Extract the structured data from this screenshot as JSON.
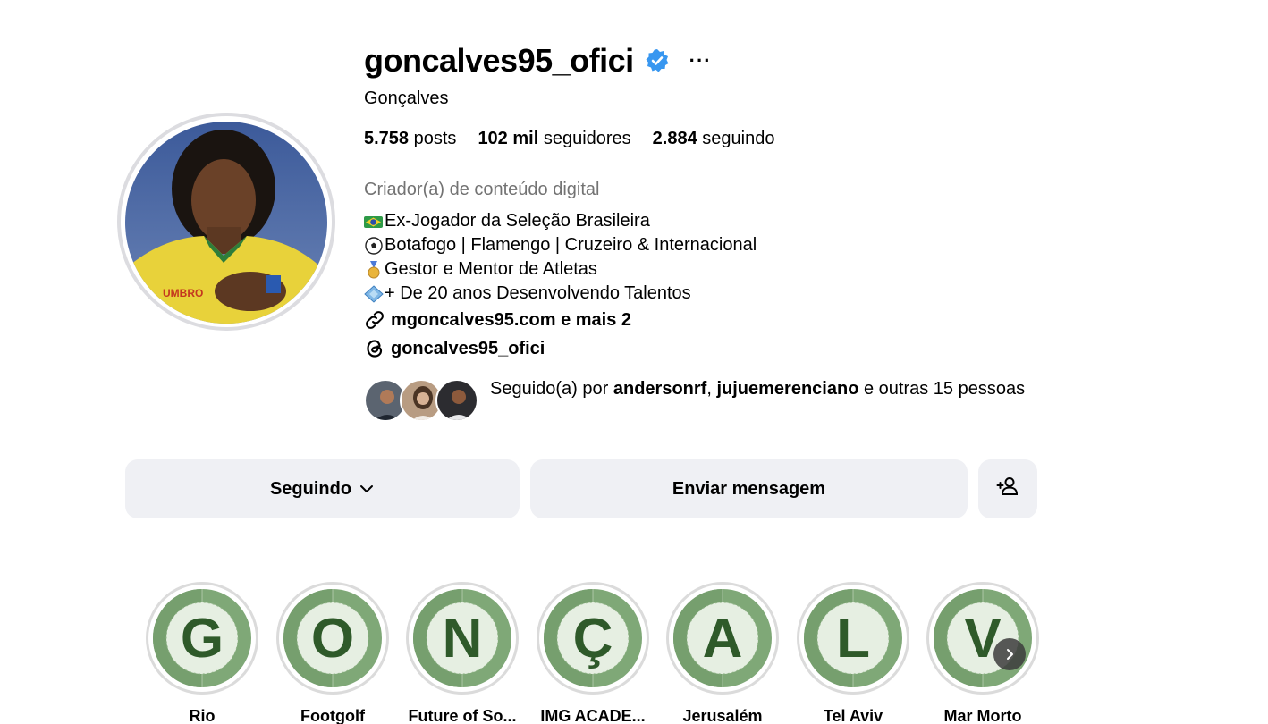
{
  "profile": {
    "username": "goncalves95_ofici",
    "full_name": "Gonçalves",
    "verified": true,
    "more_label": "···",
    "stats": {
      "posts_value": "5.758",
      "posts_label": "posts",
      "followers_value": "102 mil",
      "followers_label": "seguidores",
      "following_value": "2.884",
      "following_label": "seguindo"
    },
    "category": "Criador(a) de conteúdo digital",
    "bio": [
      {
        "icon": "brazil-flag-emoji",
        "text": "Ex-Jogador da Seleção Brasileira"
      },
      {
        "icon": "soccer-ball-emoji",
        "text": "Botafogo | Flamengo | Cruzeiro & Internacional"
      },
      {
        "icon": "medal-emoji",
        "text": "Gestor e Mentor de Atletas"
      },
      {
        "icon": "diamond-emoji",
        "text": "+ De 20 anos Desenvolvendo Talentos"
      }
    ],
    "link_text": "mgoncalves95.com e mais 2",
    "threads_handle": "goncalves95_ofici",
    "followed_by": {
      "prefix": "Seguido(a) por ",
      "user1": "andersonrf",
      "separator": ", ",
      "user2": "jujuemerenciano",
      "suffix": " e outras 15 pessoas"
    }
  },
  "actions": {
    "following_label": "Seguindo",
    "message_label": "Enviar mensagem",
    "add_icon": "add-person-icon"
  },
  "highlights": [
    {
      "letter": "G",
      "label": "Rio"
    },
    {
      "letter": "O",
      "label": "Footgolf"
    },
    {
      "letter": "N",
      "label": "Future of So..."
    },
    {
      "letter": "Ç",
      "label": "IMG ACADE..."
    },
    {
      "letter": "A",
      "label": "Jerusalém"
    },
    {
      "letter": "L",
      "label": "Tel Aviv"
    },
    {
      "letter": "V",
      "label": "Mar Morto"
    }
  ],
  "colors": {
    "verified_blue": "#3897f0",
    "button_bg": "#eff0f4",
    "secondary_text": "#737373",
    "highlight_field": "#7fa877",
    "highlight_letter": "#2f5a2a"
  }
}
